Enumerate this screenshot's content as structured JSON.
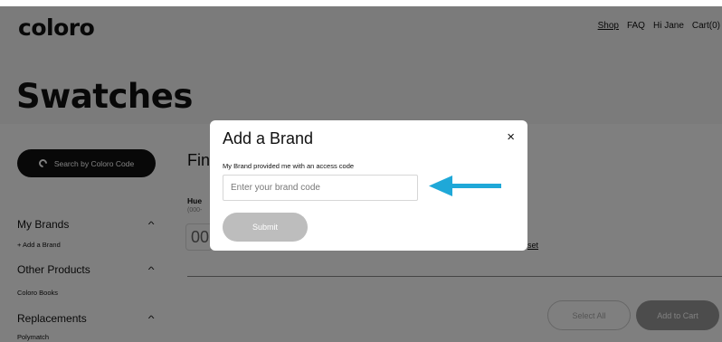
{
  "header": {
    "logo": "coloro",
    "nav": [
      "Shop",
      "FAQ",
      "Hi Jane",
      "Cart(0)"
    ],
    "active_nav": "Shop"
  },
  "page": {
    "title": "Swatches"
  },
  "sidebar": {
    "search_button": "Search by Coloro Code",
    "sections": [
      {
        "label": "My Brands",
        "sub": "+ Add a Brand"
      },
      {
        "label": "Other Products",
        "sub": "Coloro Books"
      },
      {
        "label": "Replacements",
        "sub": "Polymatch"
      }
    ]
  },
  "main": {
    "find_label_partial": "Fin",
    "hue_label": "Hue",
    "hue_range_partial": "(000-",
    "hue_value_partial": "00",
    "reset_partial": "set",
    "select_all": "Select All",
    "add_to_cart": "Add to Cart"
  },
  "modal": {
    "title": "Add a Brand",
    "close": "×",
    "label": "My Brand provided me with an access code",
    "input_placeholder": "Enter your brand code",
    "input_value": "",
    "submit": "Submit"
  },
  "colors": {
    "arrow": "#1fa8d8",
    "overlay": "rgba(0,0,0,0.5)",
    "submit_disabled": "#bdbdbd"
  }
}
